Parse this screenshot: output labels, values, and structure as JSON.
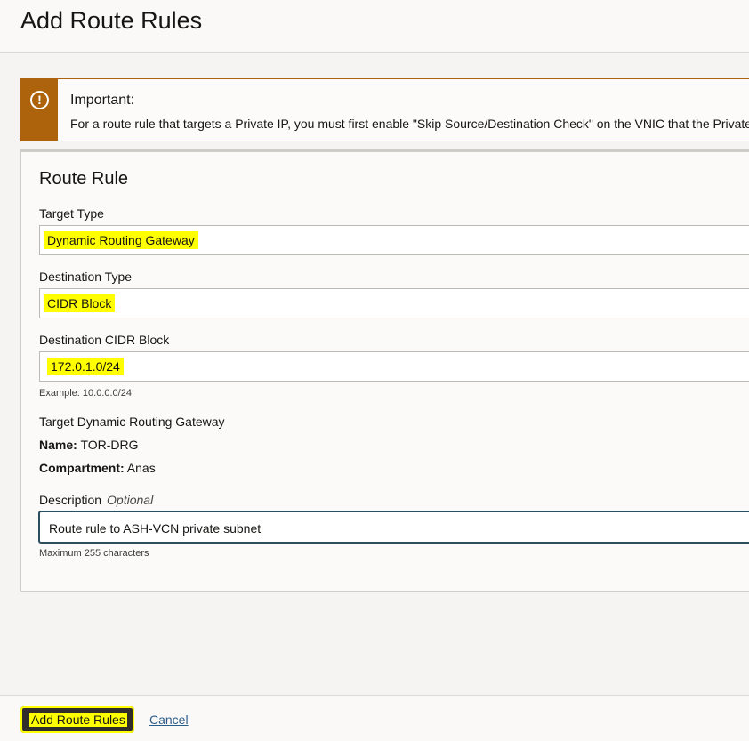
{
  "page": {
    "title": "Add Route Rules"
  },
  "alert": {
    "icon": "warning-exclamation-icon",
    "title": "Important:",
    "text": "For a route rule that targets a Private IP, you must first enable \"Skip Source/Destination Check\" on the VNIC that the Private"
  },
  "form": {
    "section_title": "Route Rule",
    "target_type": {
      "label": "Target Type",
      "value": "Dynamic Routing Gateway"
    },
    "destination_type": {
      "label": "Destination Type",
      "value": "CIDR Block"
    },
    "destination_cidr": {
      "label": "Destination CIDR Block",
      "value": "172.0.1.0/24",
      "help": "Example: 10.0.0.0/24"
    },
    "target_drg": {
      "label": "Target Dynamic Routing Gateway",
      "name_label": "Name:",
      "name_value": "TOR-DRG",
      "compartment_label": "Compartment:",
      "compartment_value": "Anas"
    },
    "description": {
      "label": "Description",
      "optional": "Optional",
      "value": "Route rule to ASH-VCN private subnet",
      "help": "Maximum 255 characters"
    }
  },
  "footer": {
    "primary_label": "Add Route Rules",
    "cancel_label": "Cancel"
  },
  "colors": {
    "alert_accent": "#ac630c",
    "highlight": "#ffff00",
    "link": "#2b5d8a",
    "primary_button": "#312d2a"
  }
}
